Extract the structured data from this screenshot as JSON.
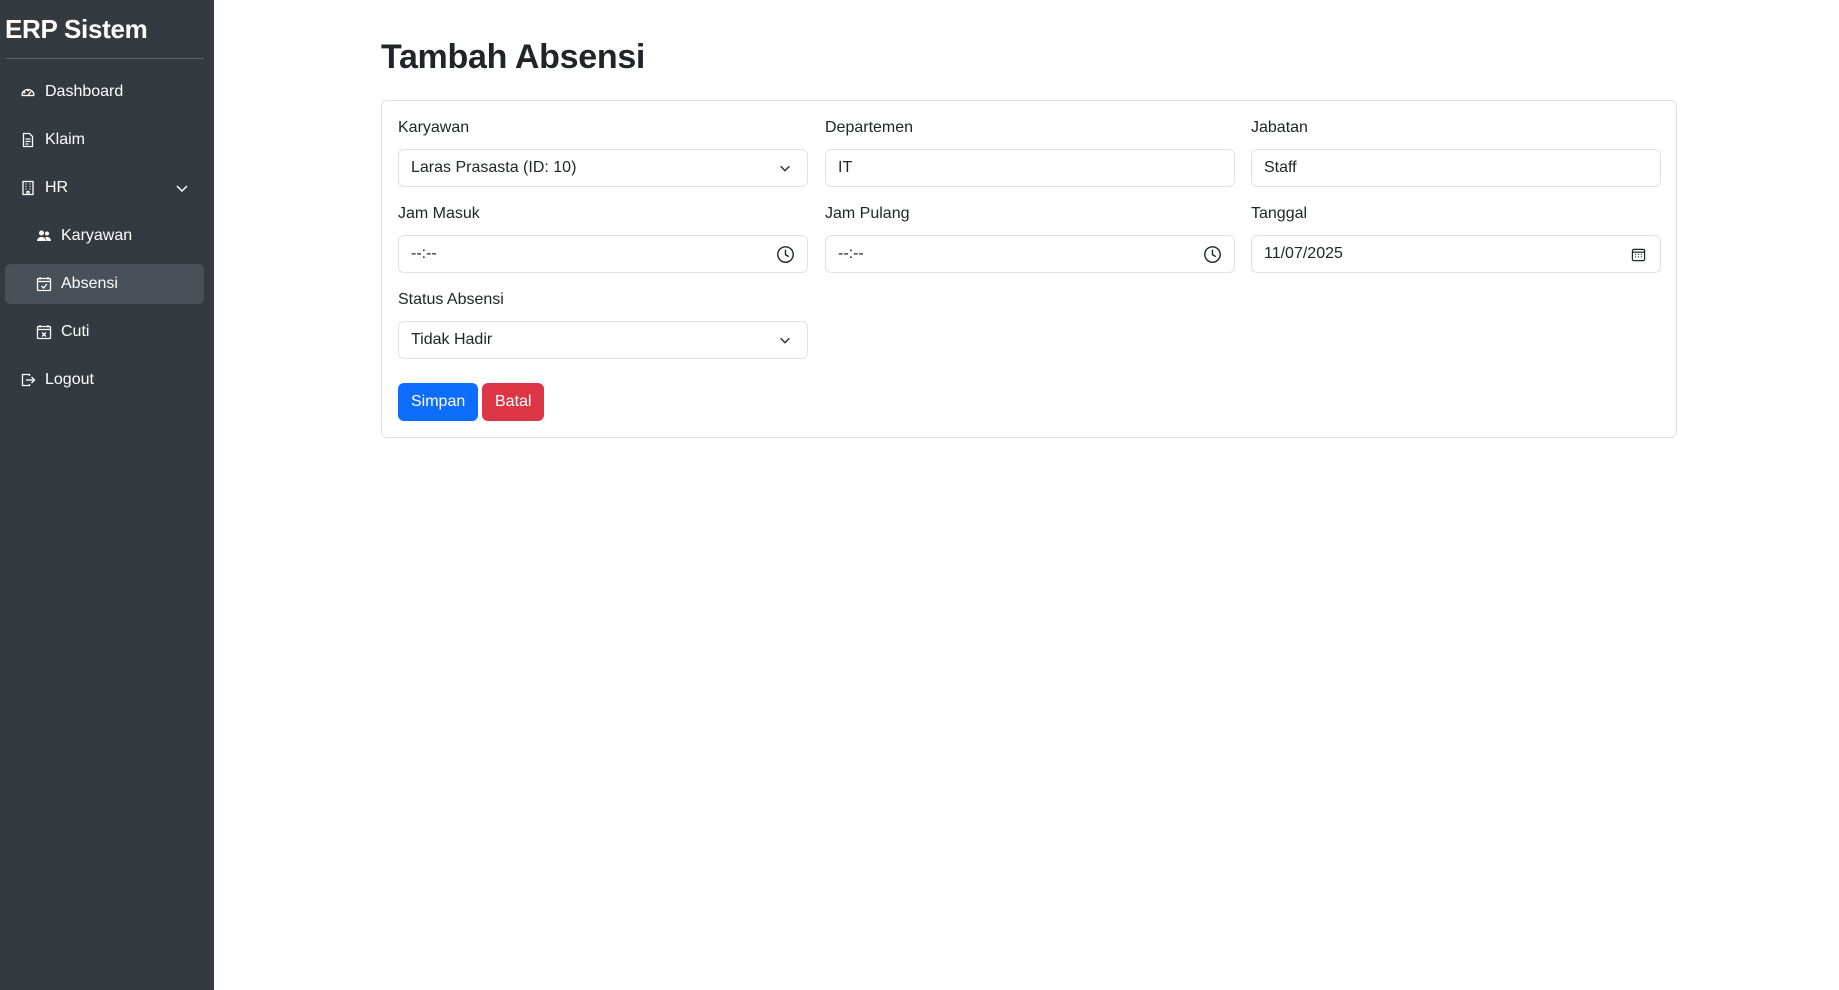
{
  "sidebar": {
    "brand": "ERP Sistem",
    "items": [
      {
        "label": "Dashboard",
        "icon": "speedometer-icon"
      },
      {
        "label": "Klaim",
        "icon": "document-icon"
      },
      {
        "label": "HR",
        "icon": "building-icon"
      },
      {
        "label": "Karyawan",
        "icon": "people-icon"
      },
      {
        "label": "Absensi",
        "icon": "calendar-check-icon"
      },
      {
        "label": "Cuti",
        "icon": "calendar-x-icon"
      },
      {
        "label": "Logout",
        "icon": "logout-icon"
      }
    ]
  },
  "page": {
    "title": "Tambah Absensi"
  },
  "form": {
    "karyawan": {
      "label": "Karyawan",
      "value": "Laras Prasasta (ID: 10)"
    },
    "departemen": {
      "label": "Departemen",
      "value": "IT"
    },
    "jabatan": {
      "label": "Jabatan",
      "value": "Staff"
    },
    "jam_masuk": {
      "label": "Jam Masuk",
      "value": "--:--"
    },
    "jam_pulang": {
      "label": "Jam Pulang",
      "value": "--:--"
    },
    "tanggal": {
      "label": "Tanggal",
      "value": "11/07/2025"
    },
    "status": {
      "label": "Status Absensi",
      "value": "Tidak Hadir"
    },
    "save_label": "Simpan",
    "cancel_label": "Batal"
  },
  "colors": {
    "sidebar_bg": "#343a40",
    "active_bg": "#495057",
    "primary": "#0d6efd",
    "danger": "#dc3545"
  }
}
